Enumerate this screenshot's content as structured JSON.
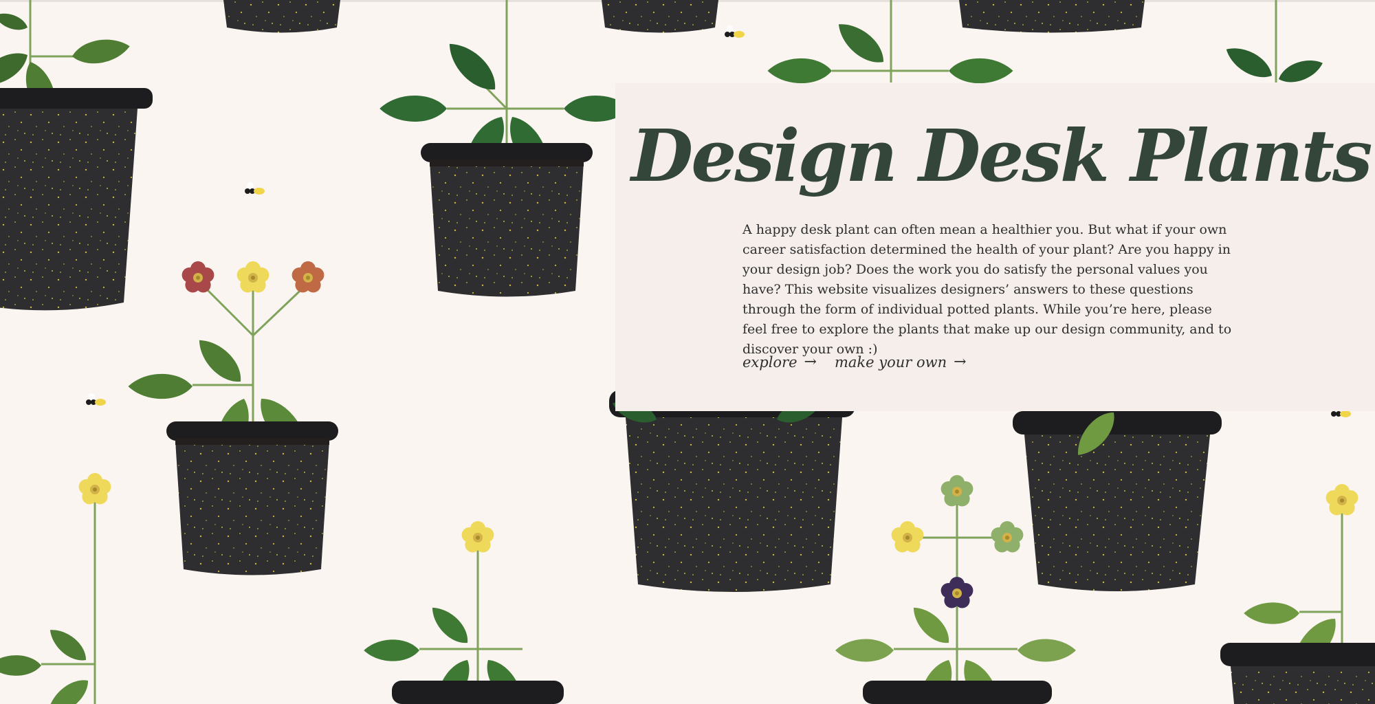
{
  "hero": {
    "title": "Design Desk Plants",
    "description": "A happy desk plant can often mean a healthier you. But what if your own career satisfaction determined the health of your plant? Are you happy in your design job? Does the work you do satisfy the personal values you have? This website visualizes designers’ answers to these questions through the form of individual potted plants. While you’re here, please feel free to explore the plants that make up our design community, and to discover your own :)"
  },
  "nav": {
    "explore_label": "explore",
    "make_label": "make your own",
    "arrow_icon": "arrow-right-icon"
  },
  "colors": {
    "background": "#fbf5f2",
    "panel": "#f5eeeb",
    "title": "#34463a",
    "pot": "#2e2e30",
    "leaf_dark": "#2f6b33",
    "leaf_light": "#6f9a42",
    "flower_yellow": "#efd95a",
    "flower_red": "#a84848",
    "flower_orange": "#c06a45",
    "flower_sage": "#8fb06a",
    "flower_purple": "#3e2d59"
  }
}
